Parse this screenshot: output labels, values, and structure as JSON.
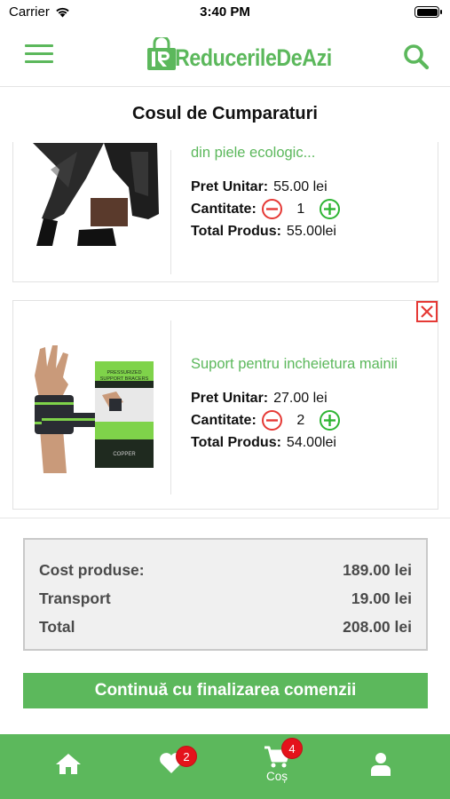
{
  "status_bar": {
    "carrier": "Carrier",
    "time": "3:40 PM"
  },
  "header": {
    "logo_text": "ReducerileDeAzi"
  },
  "page_title": "Cosul de Cumparaturi",
  "cart_items": [
    {
      "name": "din piele ecologic...",
      "unit_price_label": "Pret Unitar:",
      "unit_price": "55.00 lei",
      "quantity_label": "Cantitate:",
      "quantity": "1",
      "total_label": "Total Produs:",
      "total": "55.00lei"
    },
    {
      "name": "Suport pentru incheietura mainii",
      "unit_price_label": "Pret Unitar:",
      "unit_price": "27.00 lei",
      "quantity_label": "Cantitate:",
      "quantity": "2",
      "total_label": "Total Produs:",
      "total": "54.00lei",
      "box_text_1": "PRESSURIZED",
      "box_text_2": "SUPPORT BRACERS",
      "box_brand": "COPPER"
    }
  ],
  "summary": {
    "products_label": "Cost produse:",
    "products_value": "189.00 lei",
    "transport_label": "Transport",
    "transport_value": "19.00 lei",
    "total_label": "Total",
    "total_value": "208.00 lei"
  },
  "checkout_label": "Continuă cu finalizarea comenzii",
  "tabbar": {
    "favorites_badge": "2",
    "cart_badge": "4",
    "cart_label": "Coș"
  },
  "colors": {
    "brand_green": "#5cb85c",
    "remove_red": "#e53935",
    "plus_green": "#2fb534",
    "badge_red": "#e4131b"
  }
}
